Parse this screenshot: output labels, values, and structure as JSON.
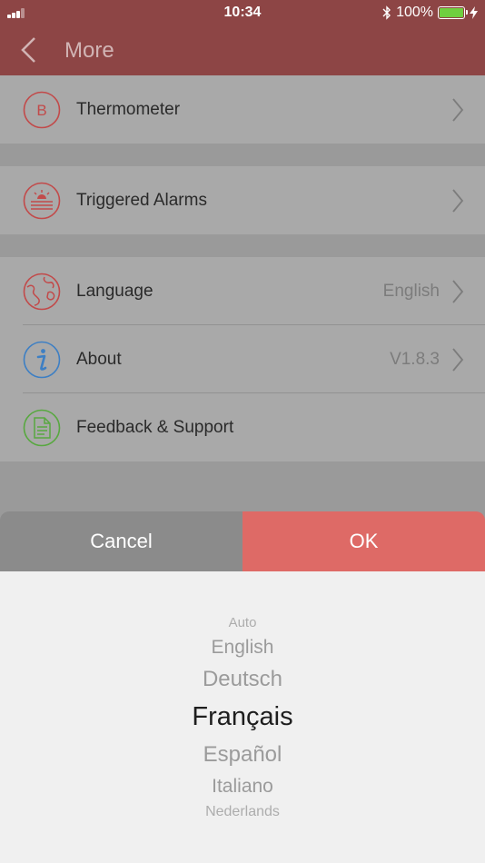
{
  "status_bar": {
    "time": "10:34",
    "battery": "100%",
    "battery_level": 1.0
  },
  "header": {
    "title": "More",
    "back_icon": "chevron-left-icon"
  },
  "menu": {
    "thermometer": {
      "label": "Thermometer",
      "icon": "thermometer-b-icon",
      "icon_letter": "B"
    },
    "alarms": {
      "label": "Triggered Alarms",
      "icon": "alarm-icon"
    },
    "language": {
      "label": "Language",
      "value": "English",
      "icon": "globe-icon"
    },
    "about": {
      "label": "About",
      "value": "V1.8.3",
      "icon": "info-icon"
    },
    "feedback": {
      "label": "Feedback & Support",
      "icon": "document-icon"
    }
  },
  "picker": {
    "cancel_label": "Cancel",
    "ok_label": "OK",
    "options": [
      "Auto",
      "English",
      "Deutsch",
      "Français",
      "Español",
      "Italiano",
      "Nederlands"
    ],
    "selected": "Français"
  },
  "colors": {
    "header_bg": "#8d4545",
    "accent_red": "#de6a66",
    "icon_red": "#c24a4a",
    "icon_blue": "#3d7fc4",
    "icon_green": "#58a840",
    "battery_green": "#6fcf3f"
  }
}
